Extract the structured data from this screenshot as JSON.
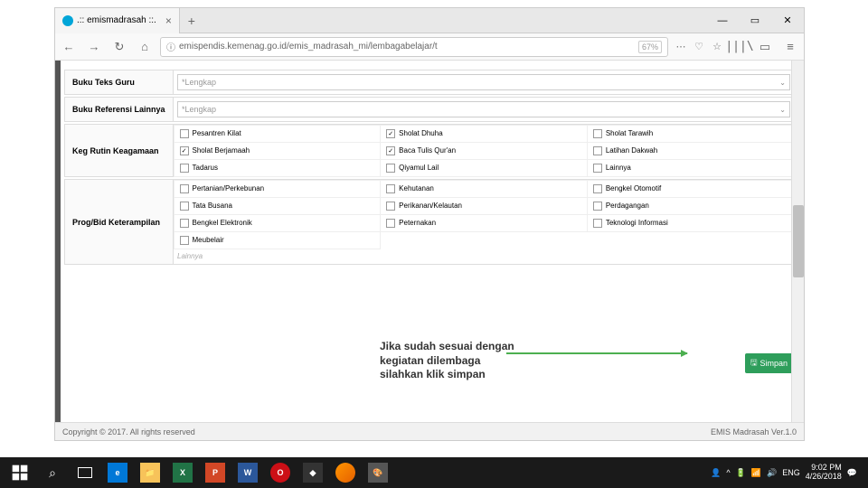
{
  "tab": {
    "title": ".:: emismadrasah ::."
  },
  "url": {
    "text": "emispendis.kemenag.go.id/emis_madrasah_mi/lembagabelajar/t",
    "zoom": "67%"
  },
  "window": {
    "min": "—",
    "max": "▭",
    "close": "✕"
  },
  "form": {
    "buku_teks_guru": {
      "label": "Buku Teks Guru",
      "value": "*Lengkap"
    },
    "buku_ref": {
      "label": "Buku Referensi Lainnya",
      "value": "*Lengkap"
    },
    "keg_rutin": {
      "label": "Keg Rutin Keagamaan",
      "items": [
        {
          "l": "Pesantren Kilat",
          "c": false
        },
        {
          "l": "Sholat Dhuha",
          "c": true
        },
        {
          "l": "Sholat Tarawih",
          "c": false
        },
        {
          "l": "Sholat Berjamaah",
          "c": true
        },
        {
          "l": "Baca Tulis Qur'an",
          "c": true
        },
        {
          "l": "Latihan Dakwah",
          "c": false
        },
        {
          "l": "Tadarus",
          "c": false
        },
        {
          "l": "Qiyamul Lail",
          "c": false
        },
        {
          "l": "Lainnya",
          "c": false
        }
      ]
    },
    "prog_bid": {
      "label": "Prog/Bid Keterampilan",
      "items": [
        {
          "l": "Pertanian/Perkebunan",
          "c": false
        },
        {
          "l": "Kehutanan",
          "c": false
        },
        {
          "l": "Bengkel Otomotif",
          "c": false
        },
        {
          "l": "Tata Busana",
          "c": false
        },
        {
          "l": "Perikanan/Kelautan",
          "c": false
        },
        {
          "l": "Perdagangan",
          "c": false
        },
        {
          "l": "Bengkel Elektronik",
          "c": false
        },
        {
          "l": "Peternakan",
          "c": false
        },
        {
          "l": "Teknologi Informasi",
          "c": false
        },
        {
          "l": "Meubelair",
          "c": false
        }
      ],
      "lainnya_placeholder": "Lainnya"
    }
  },
  "save_label": "Simpan",
  "annotation": "Jika sudah sesuai dengan kegiatan dilembaga silahkan klik simpan",
  "footer": {
    "copyright": "Copyright © 2017. All rights reserved",
    "version": "EMIS Madrasah Ver.1.0"
  },
  "tray": {
    "lang": "ENG",
    "time": "9:02 PM",
    "date": "4/26/2018"
  }
}
